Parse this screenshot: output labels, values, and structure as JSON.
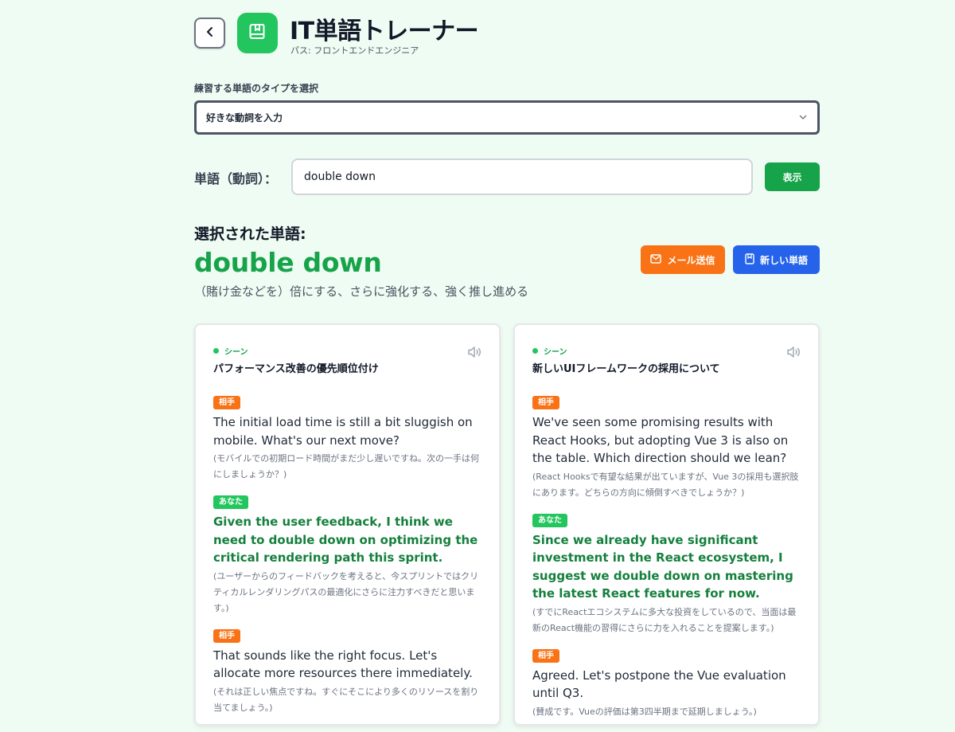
{
  "header": {
    "title": "IT単語トレーナー",
    "path": "パス: フロントエンドエンジニア"
  },
  "select": {
    "label": "練習する単語のタイプを選択",
    "value": "好きな動詞を入力"
  },
  "word_input": {
    "label": "単語（動詞）：",
    "value": "double down",
    "button": "表示"
  },
  "selected": {
    "heading": "選択された単語:",
    "word": "double down",
    "meaning": "（賭け金などを）倍にする、さらに強化する、強く推し進める",
    "mail_button": "メール送信",
    "new_word_button": "新しい単語"
  },
  "cards": [
    {
      "scene_label": "シーン",
      "title": "パフォーマンス改善の優先順位付け",
      "turns": [
        {
          "badge": "相手",
          "text": "The initial load time is still a bit sluggish on mobile. What's our next move?",
          "translation": "(モバイルでの初期ロード時間がまだ少し遅いですね。次の一手は何にしましょうか？)"
        },
        {
          "badge": "あなた",
          "text": "Given the user feedback, I think we need to double down on optimizing the critical rendering path this sprint.",
          "translation": "(ユーザーからのフィードバックを考えると、今スプリントではクリティカルレンダリングパスの最適化にさらに注力すべきだと思います。)"
        },
        {
          "badge": "相手",
          "text": "That sounds like the right focus. Let's allocate more resources there immediately.",
          "translation": "(それは正しい焦点ですね。すぐにそこにより多くのリソースを割り当てましょう。)"
        }
      ]
    },
    {
      "scene_label": "シーン",
      "title": "新しいUIフレームワークの採用について",
      "turns": [
        {
          "badge": "相手",
          "text": "We've seen some promising results with React Hooks, but adopting Vue 3 is also on the table. Which direction should we lean?",
          "translation": "(React Hooksで有望な結果が出ていますが、Vue 3の採用も選択肢にあります。どちらの方向に傾倒すべきでしょうか？)"
        },
        {
          "badge": "あなた",
          "text": "Since we already have significant investment in the React ecosystem, I suggest we double down on mastering the latest React features for now.",
          "translation": "(すでにReactエコシステムに多大な投資をしているので、当面は最新のReact機能の習得にさらに力を入れることを提案します。)"
        },
        {
          "badge": "相手",
          "text": "Agreed. Let's postpone the Vue evaluation until Q3.",
          "translation": "(賛成です。Vueの評価は第3四半期まで延期しましょう。)"
        }
      ]
    }
  ]
}
